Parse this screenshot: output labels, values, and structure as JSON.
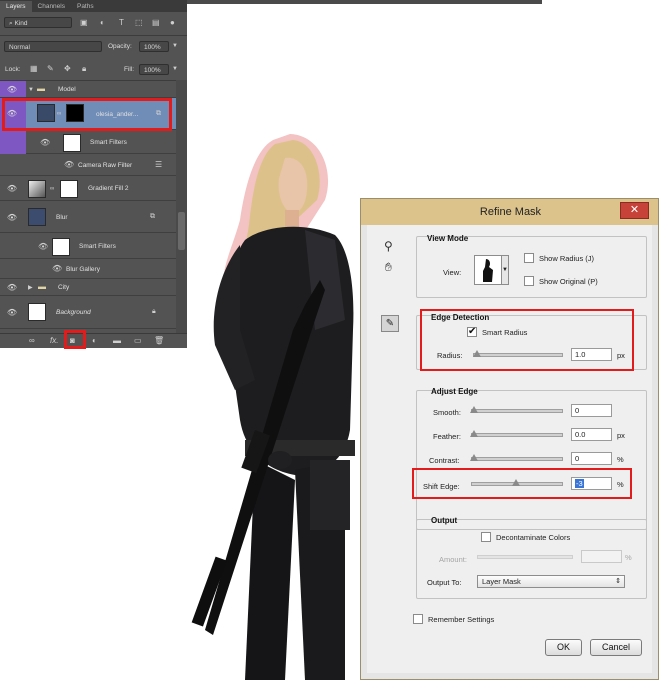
{
  "layers_panel": {
    "tabs": [
      "Layers",
      "Channels",
      "Paths"
    ],
    "filter_kind": "Kind",
    "blend_mode": "Normal",
    "opacity_label": "Opacity:",
    "opacity_value": "100%",
    "lock_label": "Lock:",
    "fill_label": "Fill:",
    "fill_value": "100%",
    "layers": [
      {
        "name": "Model",
        "type": "group"
      },
      {
        "name": "olesia_ander...",
        "type": "layer",
        "selected": true
      },
      {
        "name": "Smart Filters",
        "type": "smart-filters"
      },
      {
        "name": "Camera Raw Filter",
        "type": "filter"
      },
      {
        "name": "Gradient Fill 2",
        "type": "fill"
      },
      {
        "name": "Blur",
        "type": "layer"
      },
      {
        "name": "Smart Filters",
        "type": "smart-filters"
      },
      {
        "name": "Blur Gallery",
        "type": "filter"
      },
      {
        "name": "City",
        "type": "group"
      },
      {
        "name": "Background",
        "type": "background"
      }
    ],
    "highlight_color": "#e41b1b",
    "group_color": "#7e57c2"
  },
  "refine_mask": {
    "title": "Refine Mask",
    "view_mode": {
      "heading": "View Mode",
      "view_label": "View:",
      "show_radius": "Show Radius (J)",
      "show_original": "Show Original (P)"
    },
    "edge_detection": {
      "heading": "Edge Detection",
      "smart_radius": "Smart Radius",
      "radius_label": "Radius:",
      "radius_value": "1.0",
      "radius_unit": "px"
    },
    "adjust_edge": {
      "heading": "Adjust Edge",
      "smooth_label": "Smooth:",
      "smooth_value": "0",
      "feather_label": "Feather:",
      "feather_value": "0.0",
      "feather_unit": "px",
      "contrast_label": "Contrast:",
      "contrast_value": "0",
      "contrast_unit": "%",
      "shift_label": "Shift Edge:",
      "shift_value": "-3",
      "shift_unit": "%"
    },
    "output": {
      "heading": "Output",
      "decontaminate": "Decontaminate Colors",
      "amount_label": "Amount:",
      "amount_unit": "%",
      "output_to_label": "Output To:",
      "output_to_value": "Layer Mask"
    },
    "remember": "Remember Settings",
    "ok": "OK",
    "cancel": "Cancel"
  }
}
